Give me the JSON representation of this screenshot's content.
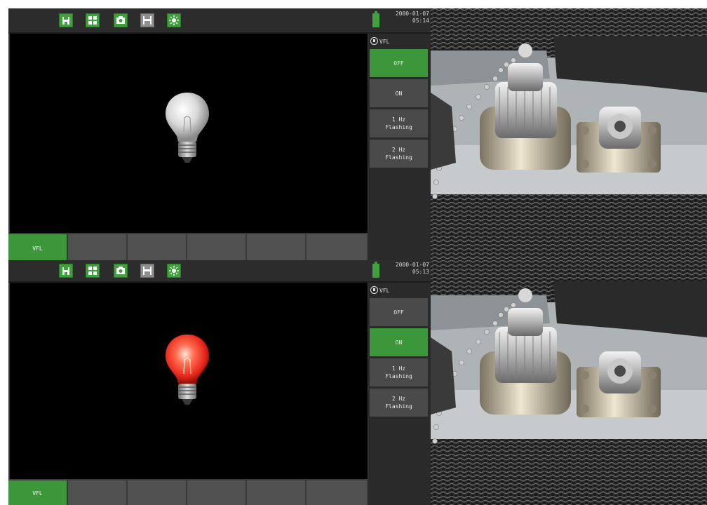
{
  "toolbar_icons": [
    "save-icon",
    "fit-icon",
    "camera-icon",
    "floppy-icon",
    "brightness-icon"
  ],
  "top": {
    "date": "2000-01-07",
    "time": "05:14",
    "vfl_label": "VFL",
    "bulb_state": "off",
    "modes": [
      {
        "label": "OFF",
        "active": true
      },
      {
        "label": "ON",
        "active": false
      },
      {
        "label": "1 Hz\nFlashing",
        "active": false
      },
      {
        "label": "2 Hz\nFlashing",
        "active": false
      }
    ],
    "tabs": [
      "VFL",
      "",
      "",
      "",
      "",
      ""
    ]
  },
  "bottom": {
    "date": "2000-01-07",
    "time": "05:13",
    "vfl_label": "VFL",
    "bulb_state": "on",
    "modes": [
      {
        "label": "OFF",
        "active": false
      },
      {
        "label": "ON",
        "active": true
      },
      {
        "label": "1 Hz\nFlashing",
        "active": false
      },
      {
        "label": "2 Hz\nFlashing",
        "active": false
      }
    ],
    "tabs": [
      "VFL",
      "",
      "",
      "",
      "",
      ""
    ]
  },
  "colors": {
    "accent_green": "#3c963a",
    "panel_dark": "#2a2a2a",
    "button_grey": "#4a4a4a",
    "bulb_on_red": "#e8281c"
  }
}
